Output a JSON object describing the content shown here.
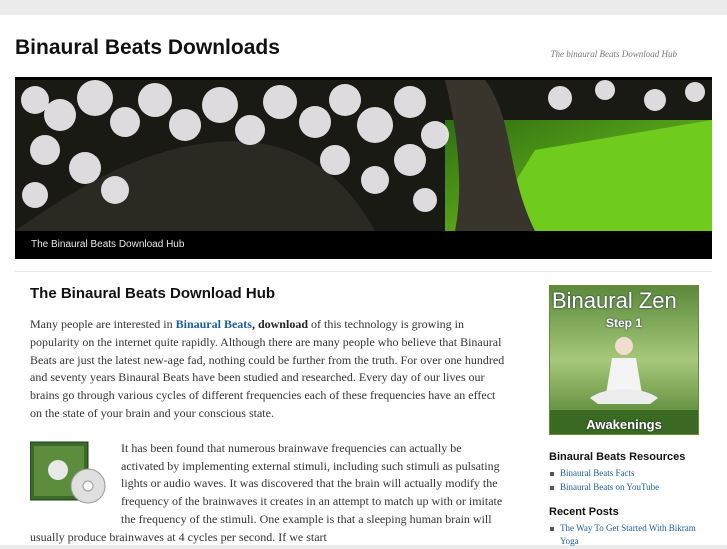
{
  "site": {
    "title": "Binaural Beats Downloads",
    "description": "The binaural Beats Download Hub"
  },
  "nav": {
    "items": [
      "The Binaural Beats Download Hub"
    ]
  },
  "post": {
    "title": "The Binaural Beats Download Hub",
    "para1_pre": "Many people are interested in ",
    "para1_link": "Binaural Beats",
    "para1_comma": ", ",
    "para1_bold": "download",
    "para1_post": " of this technology is growing in popularity on the internet quite rapidly. Although there are many people who believe that Binaural Beats are just the latest new-age fad, nothing could be further from the truth. For over one hundred and seventy years Binaural Beats have been studied and researched. Every day of our lives our brains go through various cycles of different frequencies each of these frequencies have an effect on the state of your brain and your conscious state.",
    "para2": "It has been found that numerous brainwave frequencies can actually be activated by implementing external stimuli, including such stimuli as pulsating lights or audio waves. It was discovered that the brain will actually modify the frequency of the brainwaves it creates in an attempt to match up with or imitate the frequency of the stimuli. One example is that a sleeping human brain will usually produce brainwaves at 4 cycles per second. If we start"
  },
  "sidebar": {
    "ad": {
      "top": "Binaural Zen",
      "step": "Step 1",
      "bottom": "Awakenings"
    },
    "resources": {
      "title": "Binaural Beats Resources",
      "links": [
        "Binaural Beats Facts",
        "Binaural Beats on YouTube"
      ]
    },
    "recent": {
      "title": "Recent Posts",
      "links": [
        "The Way To Get Started With Bikram Yoga"
      ]
    }
  }
}
